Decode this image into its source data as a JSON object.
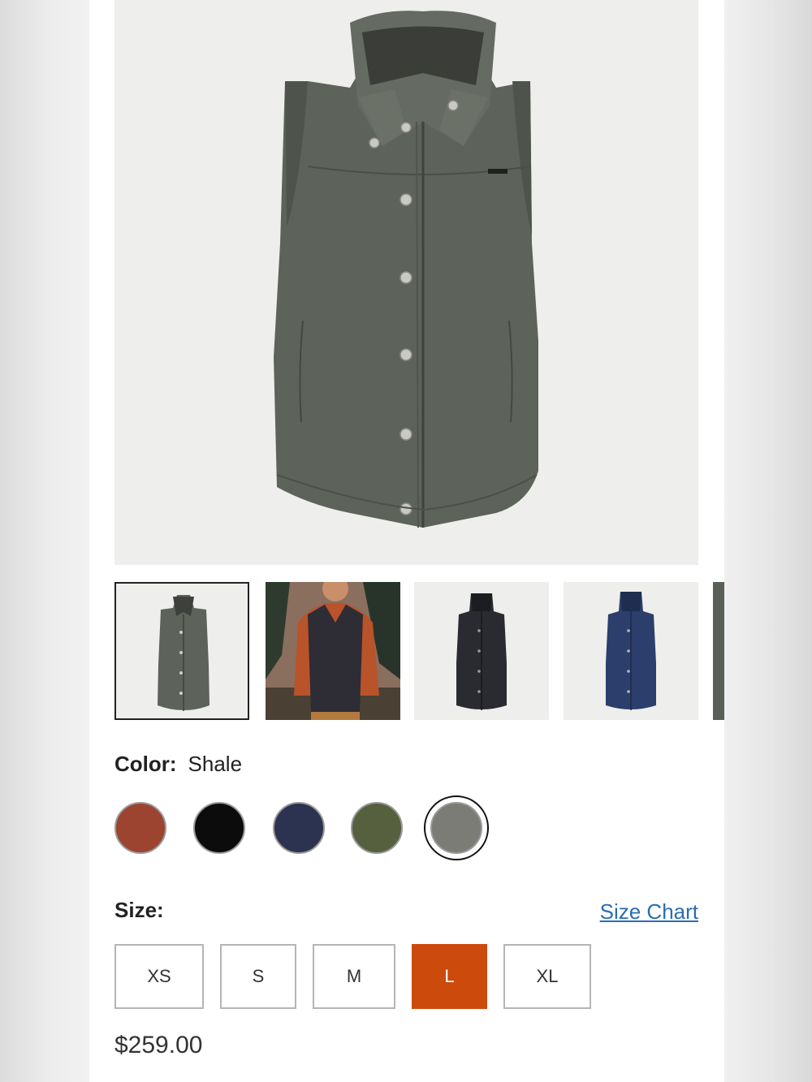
{
  "product": {
    "price": "$259.00"
  },
  "color": {
    "label": "Color:",
    "selected_name": "Shale",
    "swatches": [
      {
        "name": "rust",
        "hex": "#9c4430"
      },
      {
        "name": "black",
        "hex": "#0c0c0c"
      },
      {
        "name": "navy",
        "hex": "#2b3350"
      },
      {
        "name": "olive",
        "hex": "#56603f"
      },
      {
        "name": "shale",
        "hex": "#7b7c75",
        "selected": true
      }
    ]
  },
  "size": {
    "label": "Size:",
    "chart_link": "Size Chart",
    "options": [
      "XS",
      "S",
      "M",
      "L",
      "XL"
    ],
    "selected": "L"
  },
  "thumbnails": [
    {
      "name": "shale-front",
      "vest_color": "#5d625a",
      "active": true
    },
    {
      "name": "lifestyle-model",
      "vest_color": "#2e2c34",
      "active": false
    },
    {
      "name": "black-front",
      "vest_color": "#2a2b30",
      "active": false
    },
    {
      "name": "navy-front",
      "vest_color": "#2c3e6b",
      "active": false
    },
    {
      "name": "partial",
      "vest_color": "#5a5f58",
      "active": false
    }
  ],
  "colors": {
    "accent": "#cc4a0c",
    "link": "#2a6db2",
    "vest_main": "#5d625a"
  }
}
